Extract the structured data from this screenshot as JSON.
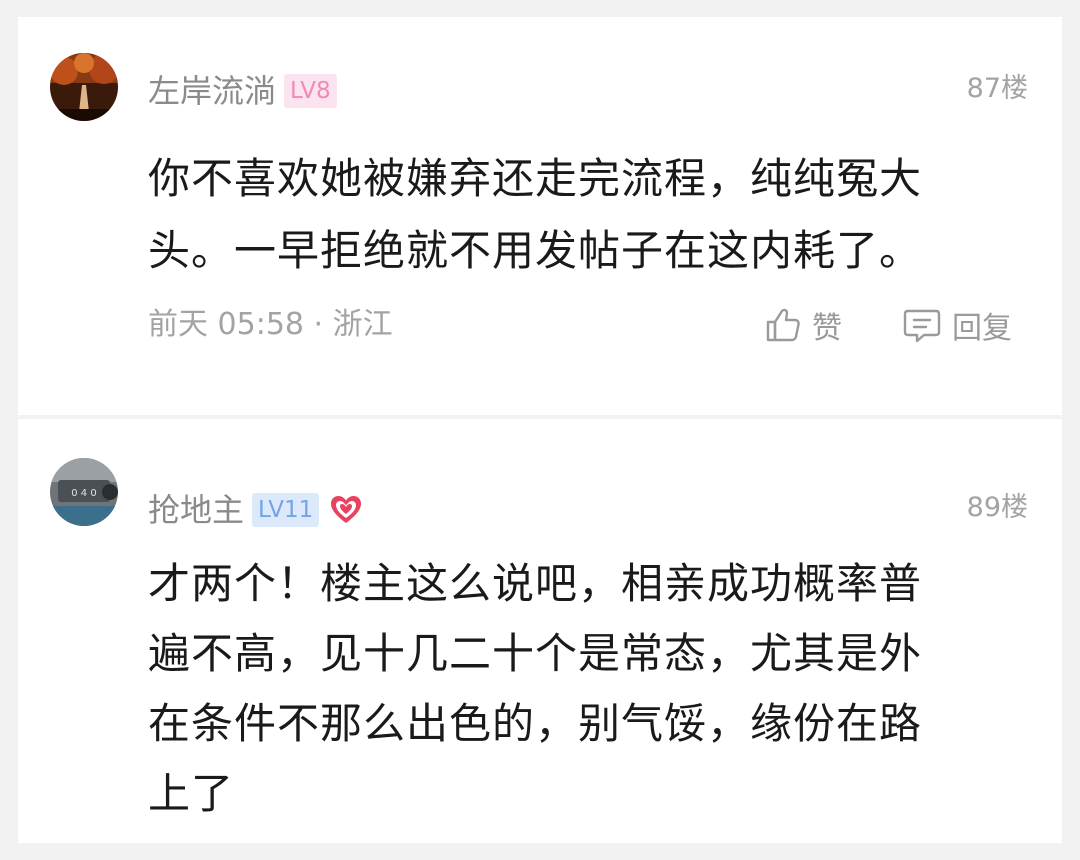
{
  "comments": [
    {
      "username": "左岸流淌",
      "level": "LV8",
      "floor": "87楼",
      "content_lines": [
        "你不喜欢她被嫌弃还走完流程，纯纯冤大",
        "头。一早拒绝就不用发帖子在这内耗了。"
      ],
      "time": "前天 05:58 · 浙江",
      "like_label": "赞",
      "reply_label": "回复",
      "avatar_icon": "autumn-path-avatar",
      "level_color": "#ef8bb8"
    },
    {
      "username": "抢地主",
      "level": "LV11",
      "floor": "89楼",
      "content_lines": [
        "才两个！楼主这么说吧，相亲成功概率普",
        "遍不高，见十几二十个是常态，尤其是外",
        "在条件不那么出色的，别气馁，缘份在路",
        "上了"
      ],
      "level_color": "#74a3e6",
      "badge_icon": "heart-badge-icon",
      "avatar_icon": "car-plate-avatar"
    }
  ],
  "colors": {
    "text": "#1a1a1a",
    "secondary": "#8a8a8a",
    "heart": "#e8425f"
  }
}
